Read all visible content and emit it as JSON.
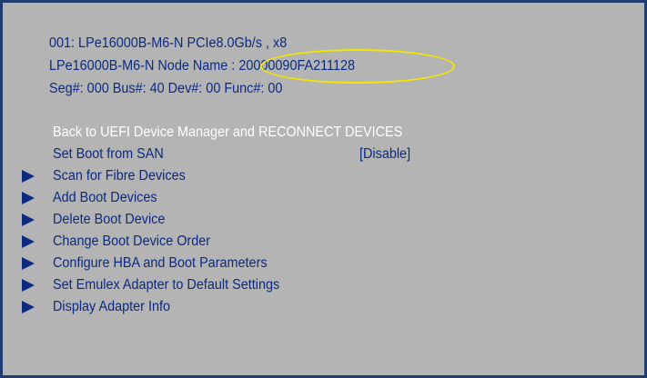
{
  "adapter_info": {
    "adapter_line": "001: LPe16000B-M6-N PCIe8.0Gb/s , x8",
    "node_name_label": "LPe16000B-M6-N Node Name :",
    "node_name_value": "20000090FA211128",
    "pci_location": "Seg#: 000 Bus#: 40 Dev#: 00 Func#: 00"
  },
  "menu": {
    "back_reconnect": "Back to UEFI Device Manager and RECONNECT DEVICES",
    "set_boot_from_san": {
      "label": "Set Boot from SAN",
      "value": "[Disable]"
    },
    "submenus": [
      "Scan for Fibre Devices",
      "Add Boot Devices",
      "Delete Boot Device",
      "Change Boot Device Order",
      "Configure HBA and Boot Parameters",
      "Set Emulex Adapter to Default Settings",
      "Display Adapter Info"
    ]
  },
  "colors": {
    "background": "#b4b4b4",
    "text": "#0b2a80",
    "selected_text": "#ffffff",
    "annotation_ellipse": "#f5e600",
    "frame_border": "#1f3c6e"
  }
}
